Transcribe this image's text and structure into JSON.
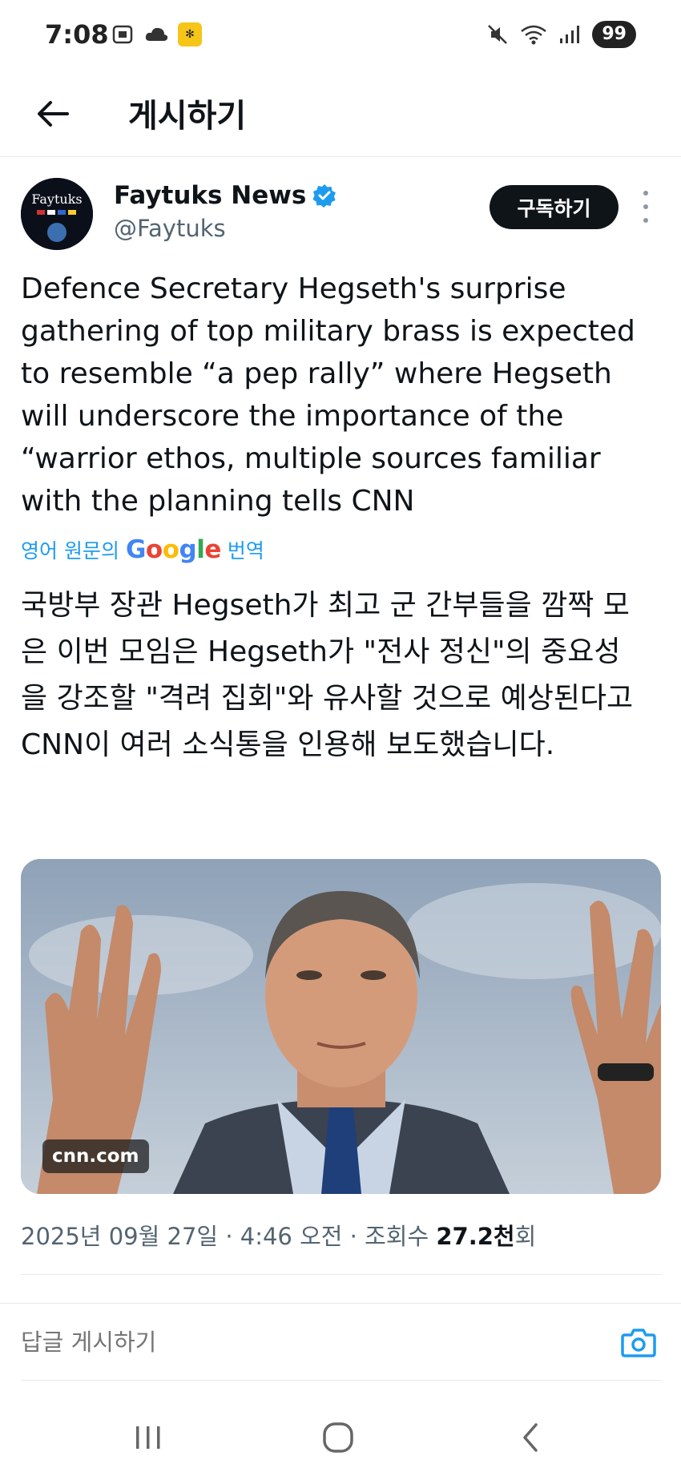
{
  "status_bar": {
    "time": "7:08",
    "battery": "99",
    "app_badge": "✻"
  },
  "header": {
    "title": "게시하기"
  },
  "post": {
    "author_name": "Faytuks News",
    "author_handle": "@Faytuks",
    "avatar_text": "Faytuks",
    "subscribe_label": "구독하기",
    "text": "Defence Secretary Hegseth's surprise gathering of top military brass is expected to resemble “a pep rally” where Hegseth will underscore the importance of the “warrior ethos, multiple sources familiar with the planning tells CNN",
    "translate_prefix": "영어 원문의",
    "translate_brand": "Google",
    "translate_suffix": "번역",
    "translated_text": "국방부 장관 Hegseth가 최고 군 간부들을 깜짝 모은 이번 모임은 Hegseth가 \"전사 정신\"의 중요성을 강조할 \"격려 집회\"와 유사할 것으로 예상된다고 CNN이 여러 소식통을 인용해 보도했습니다.",
    "media_source": "cnn.com",
    "date": "2025년 09월 27일",
    "time": "4:46 오전",
    "views_label": "조회수",
    "views_count": "27.2천",
    "views_suffix": "회"
  },
  "reply": {
    "placeholder": "답글 게시하기"
  },
  "colors": {
    "accent": "#1d9bf0",
    "text": "#0f1419",
    "muted": "#536471"
  }
}
